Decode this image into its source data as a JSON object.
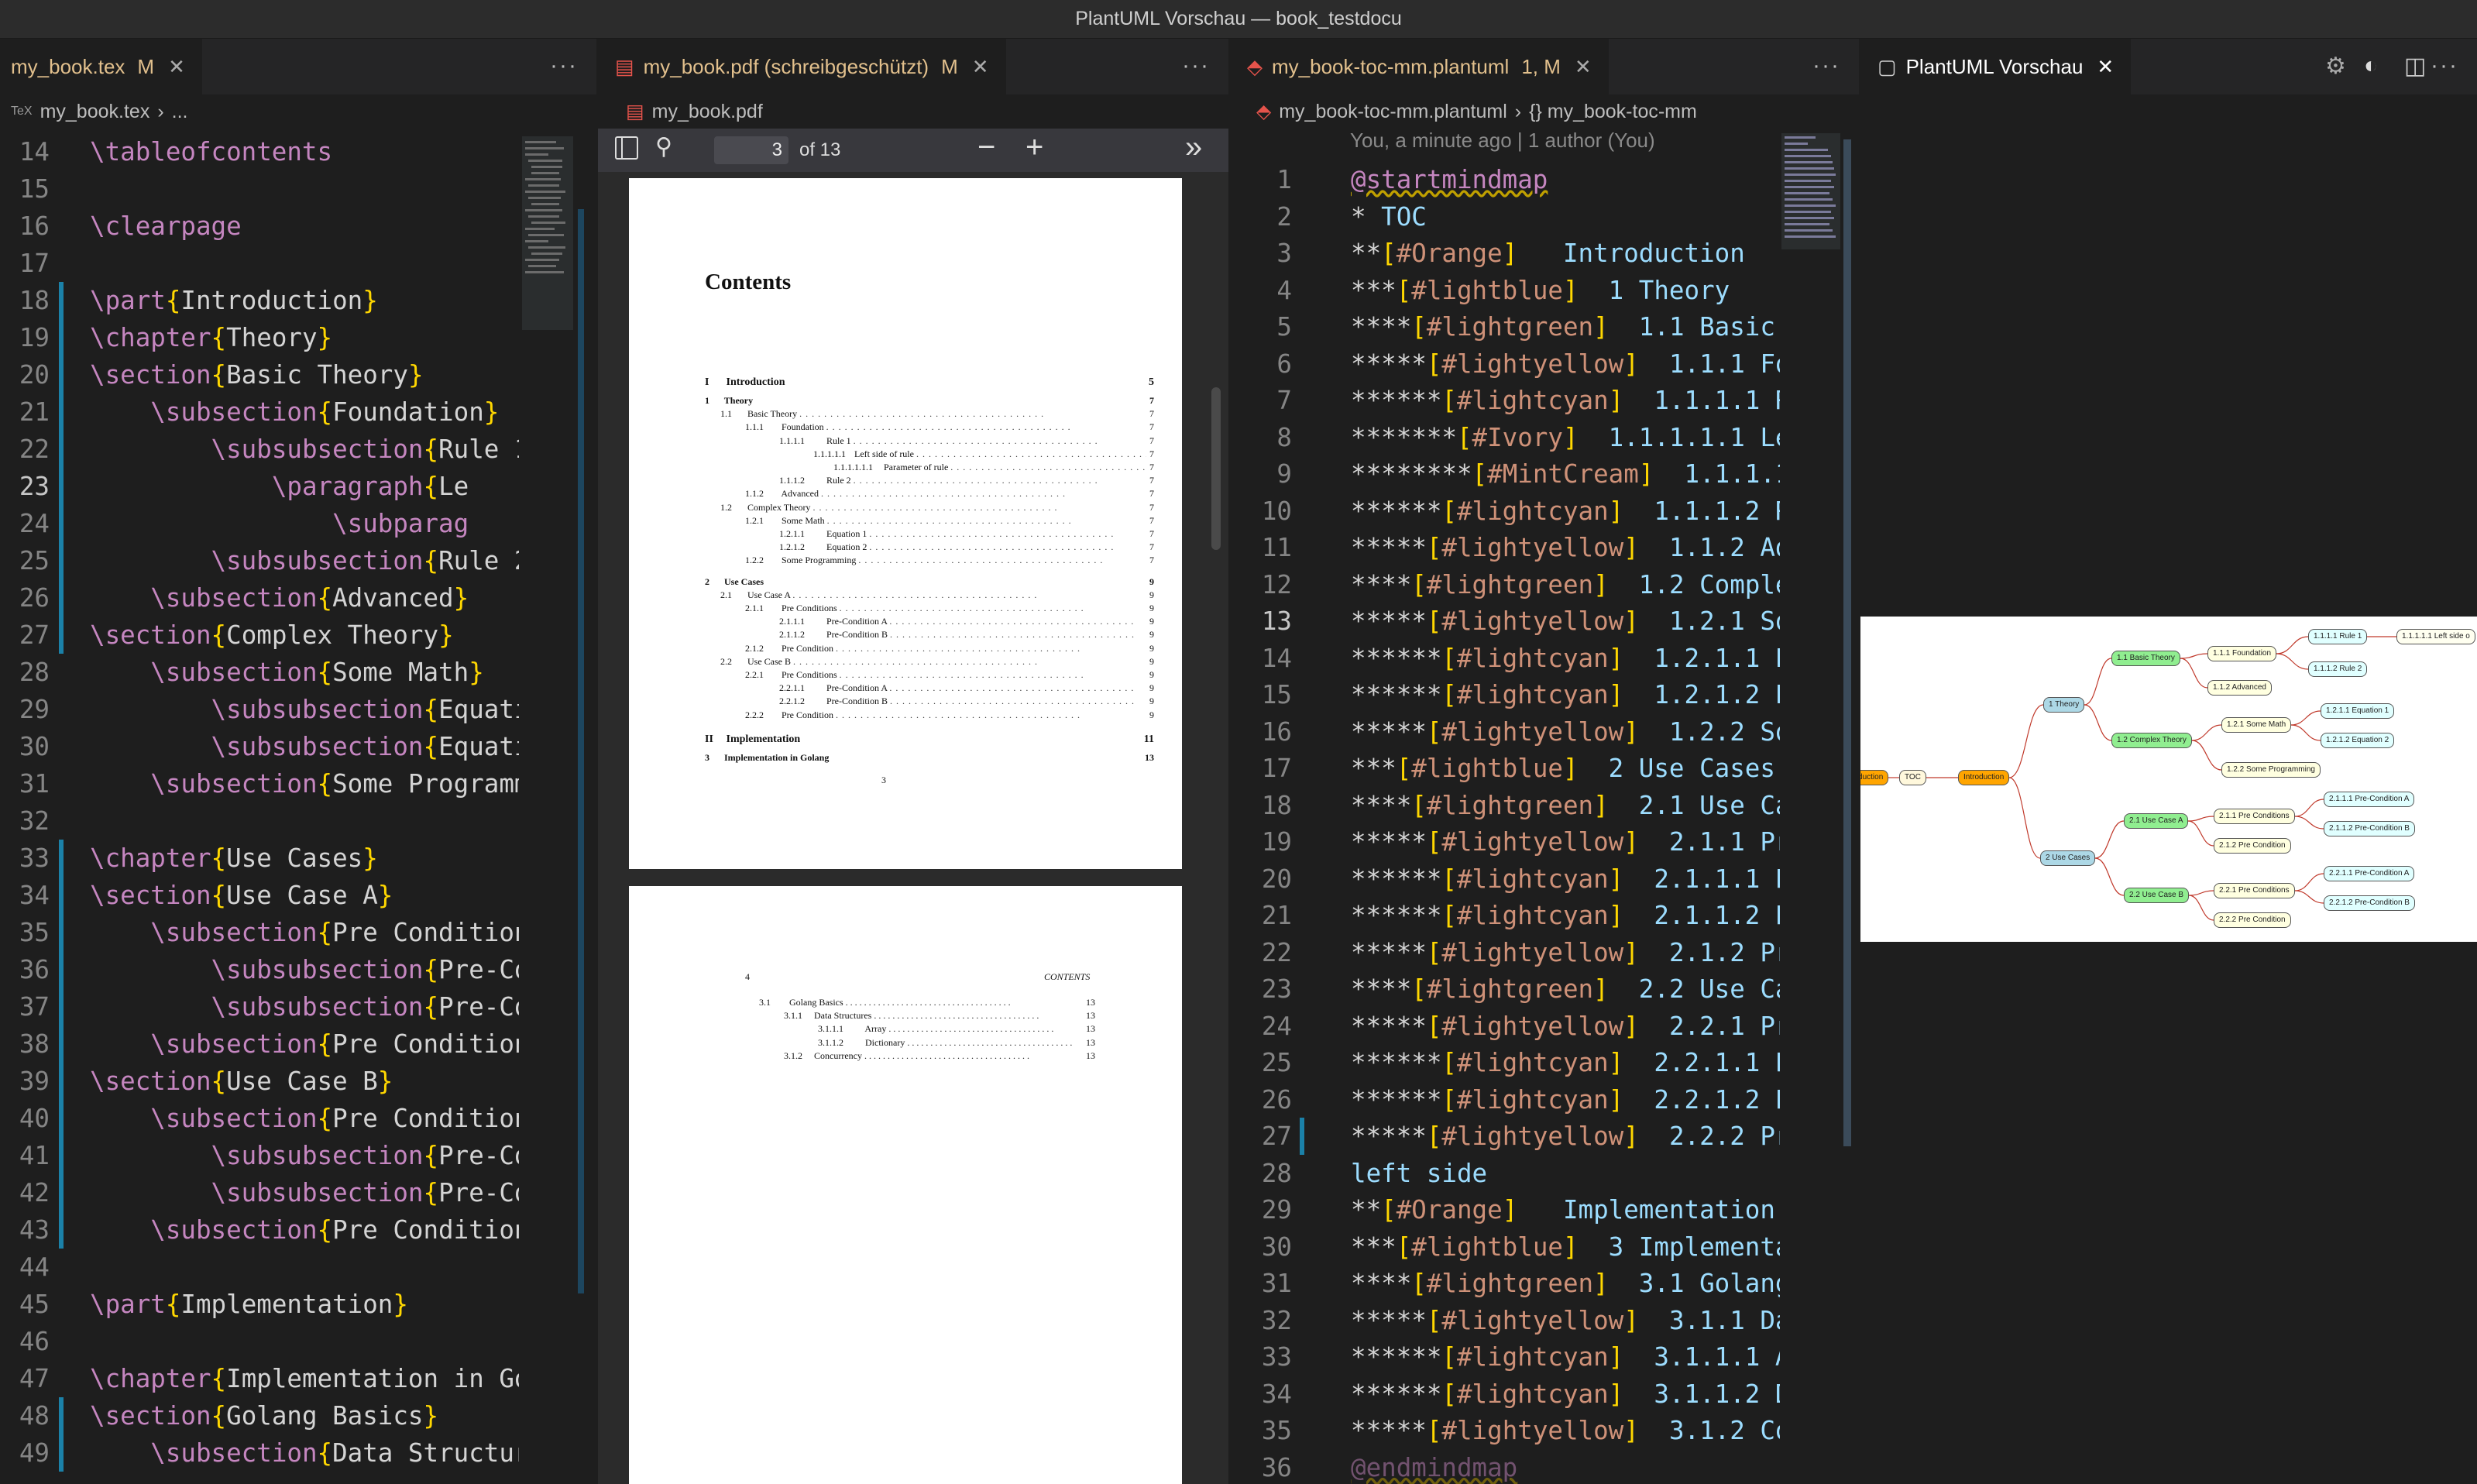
{
  "window_title": "PlantUML Vorschau — book_testdocu",
  "pane1": {
    "tab": {
      "label": "my_book.tex",
      "mod": "M"
    },
    "breadcrumb": [
      "my_book.tex",
      "..."
    ],
    "lines": [
      {
        "n": "14",
        "t": "\\tableofcontents"
      },
      {
        "n": "15",
        "t": ""
      },
      {
        "n": "16",
        "t": "\\clearpage"
      },
      {
        "n": "17",
        "t": ""
      },
      {
        "n": "18",
        "t": "\\part{Introduction}"
      },
      {
        "n": "19",
        "t": "\\chapter{Theory}"
      },
      {
        "n": "20",
        "t": "\\section{Basic Theory}"
      },
      {
        "n": "21",
        "t": "    \\subsection{Foundation}"
      },
      {
        "n": "22",
        "t": "        \\subsubsection{Rule 1"
      },
      {
        "n": "23",
        "t": "            \\paragraph{Le"
      },
      {
        "n": "24",
        "t": "                \\subparag"
      },
      {
        "n": "25",
        "t": "        \\subsubsection{Rule 2"
      },
      {
        "n": "26",
        "t": "    \\subsection{Advanced}"
      },
      {
        "n": "27",
        "t": "\\section{Complex Theory}"
      },
      {
        "n": "28",
        "t": "    \\subsection{Some Math}"
      },
      {
        "n": "29",
        "t": "        \\subsubsection{Equati"
      },
      {
        "n": "30",
        "t": "        \\subsubsection{Equati"
      },
      {
        "n": "31",
        "t": "    \\subsection{Some Programm"
      },
      {
        "n": "32",
        "t": ""
      },
      {
        "n": "33",
        "t": "\\chapter{Use Cases}"
      },
      {
        "n": "34",
        "t": "\\section{Use Case A}"
      },
      {
        "n": "35",
        "t": "    \\subsection{Pre Condition"
      },
      {
        "n": "36",
        "t": "        \\subsubsection{Pre-Co"
      },
      {
        "n": "37",
        "t": "        \\subsubsection{Pre-Co"
      },
      {
        "n": "38",
        "t": "    \\subsection{Pre Condition"
      },
      {
        "n": "39",
        "t": "\\section{Use Case B}"
      },
      {
        "n": "40",
        "t": "    \\subsection{Pre Condition"
      },
      {
        "n": "41",
        "t": "        \\subsubsection{Pre-Co"
      },
      {
        "n": "42",
        "t": "        \\subsubsection{Pre-Co"
      },
      {
        "n": "43",
        "t": "    \\subsection{Pre Condition"
      },
      {
        "n": "44",
        "t": ""
      },
      {
        "n": "45",
        "t": "\\part{Implementation}"
      },
      {
        "n": "46",
        "t": ""
      },
      {
        "n": "47",
        "t": "\\chapter{Implementation in Go"
      },
      {
        "n": "48",
        "t": "\\section{Golang Basics}"
      },
      {
        "n": "49",
        "t": "    \\subsection{Data Structur"
      }
    ]
  },
  "pane2": {
    "tab": {
      "label": "my_book.pdf (schreibgeschützt)",
      "mod": "M"
    },
    "breadcrumb": "my_book.pdf",
    "page_input": "3",
    "page_total": "of 13",
    "page3": {
      "heading": "Contents",
      "entries": [
        {
          "num": "I",
          "title": "Introduction",
          "page": "5",
          "level": 0
        },
        {
          "num": "1",
          "title": "Theory",
          "page": "7",
          "level": 1
        },
        {
          "num": "1.1",
          "title": "Basic Theory",
          "page": "7",
          "level": 2
        },
        {
          "num": "1.1.1",
          "title": "Foundation",
          "page": "7",
          "level": 3
        },
        {
          "num": "1.1.1.1",
          "title": "Rule 1",
          "page": "7",
          "level": 4
        },
        {
          "num": "1.1.1.1.1",
          "title": "Left side of rule",
          "page": "7",
          "level": 5
        },
        {
          "num": "1.1.1.1.1.1",
          "title": "Parameter of rule",
          "page": "7",
          "level": 6
        },
        {
          "num": "1.1.1.2",
          "title": "Rule 2",
          "page": "7",
          "level": 4
        },
        {
          "num": "1.1.2",
          "title": "Advanced",
          "page": "7",
          "level": 3
        },
        {
          "num": "1.2",
          "title": "Complex Theory",
          "page": "7",
          "level": 2
        },
        {
          "num": "1.2.1",
          "title": "Some Math",
          "page": "7",
          "level": 3
        },
        {
          "num": "1.2.1.1",
          "title": "Equation 1",
          "page": "7",
          "level": 4
        },
        {
          "num": "1.2.1.2",
          "title": "Equation 2",
          "page": "7",
          "level": 4
        },
        {
          "num": "1.2.2",
          "title": "Some Programming",
          "page": "7",
          "level": 3
        },
        {
          "num": "2",
          "title": "Use Cases",
          "page": "9",
          "level": 1
        },
        {
          "num": "2.1",
          "title": "Use Case A",
          "page": "9",
          "level": 2
        },
        {
          "num": "2.1.1",
          "title": "Pre Conditions",
          "page": "9",
          "level": 3
        },
        {
          "num": "2.1.1.1",
          "title": "Pre-Condition A",
          "page": "9",
          "level": 4
        },
        {
          "num": "2.1.1.2",
          "title": "Pre-Condition B",
          "page": "9",
          "level": 4
        },
        {
          "num": "2.1.2",
          "title": "Pre Condition",
          "page": "9",
          "level": 3
        },
        {
          "num": "2.2",
          "title": "Use Case B",
          "page": "9",
          "level": 2
        },
        {
          "num": "2.2.1",
          "title": "Pre Conditions",
          "page": "9",
          "level": 3
        },
        {
          "num": "2.2.1.1",
          "title": "Pre-Condition A",
          "page": "9",
          "level": 4
        },
        {
          "num": "2.2.1.2",
          "title": "Pre-Condition B",
          "page": "9",
          "level": 4
        },
        {
          "num": "2.2.2",
          "title": "Pre Condition",
          "page": "9",
          "level": 3
        },
        {
          "num": "II",
          "title": "Implementation",
          "page": "11",
          "level": 0
        },
        {
          "num": "3",
          "title": "Implementation in Golang",
          "page": "13",
          "level": 1
        }
      ],
      "footer": "3"
    },
    "page4": {
      "header_left": "4",
      "header_right": "CONTENTS",
      "entries": [
        {
          "num": "3.1",
          "title": "Golang Basics",
          "page": "13",
          "level": 2
        },
        {
          "num": "3.1.1",
          "title": "Data Structures",
          "page": "13",
          "level": 3
        },
        {
          "num": "3.1.1.1",
          "title": "Array",
          "page": "13",
          "level": 4
        },
        {
          "num": "3.1.1.2",
          "title": "Dictionary",
          "page": "13",
          "level": 4
        },
        {
          "num": "3.1.2",
          "title": "Concurrency",
          "page": "13",
          "level": 3
        }
      ]
    }
  },
  "pane3": {
    "tab": {
      "label": "my_book-toc-mm.plantuml",
      "mod": "1, M"
    },
    "breadcrumb": [
      "my_book-toc-mm.plantuml",
      "{} my_book-toc-mm"
    ],
    "blame": "You, a minute ago | 1 author (You)",
    "lines": [
      {
        "n": "1",
        "s": "",
        "c": "",
        "t": "@startmindmap"
      },
      {
        "n": "2",
        "s": "* ",
        "c": "",
        "t": "TOC"
      },
      {
        "n": "3",
        "s": "**",
        "c": "[#Orange]",
        "t": "   Introduction"
      },
      {
        "n": "4",
        "s": "***",
        "c": "[#lightblue]",
        "t": "  1 Theory"
      },
      {
        "n": "5",
        "s": "****",
        "c": "[#lightgreen]",
        "t": "  1.1 Basic"
      },
      {
        "n": "6",
        "s": "*****",
        "c": "[#lightyellow]",
        "t": "  1.1.1 Fo"
      },
      {
        "n": "7",
        "s": "******",
        "c": "[#lightcyan]",
        "t": "  1.1.1.1 R"
      },
      {
        "n": "8",
        "s": "*******",
        "c": "[#Ivory]",
        "t": "  1.1.1.1.1 Le"
      },
      {
        "n": "9",
        "s": "********",
        "c": "[#MintCream]",
        "t": "  1.1.1.1"
      },
      {
        "n": "10",
        "s": "******",
        "c": "[#lightcyan]",
        "t": "  1.1.1.2 R"
      },
      {
        "n": "11",
        "s": "*****",
        "c": "[#lightyellow]",
        "t": "  1.1.2 Ad"
      },
      {
        "n": "12",
        "s": "****",
        "c": "[#lightgreen]",
        "t": "  1.2 Comple"
      },
      {
        "n": "13",
        "s": "*****",
        "c": "[#lightyellow]",
        "t": "  1.2.1 So"
      },
      {
        "n": "14",
        "s": "******",
        "c": "[#lightcyan]",
        "t": "  1.2.1.1 E"
      },
      {
        "n": "15",
        "s": "******",
        "c": "[#lightcyan]",
        "t": "  1.2.1.2 E"
      },
      {
        "n": "16",
        "s": "*****",
        "c": "[#lightyellow]",
        "t": "  1.2.2 So"
      },
      {
        "n": "17",
        "s": "***",
        "c": "[#lightblue]",
        "t": "  2 Use Cases"
      },
      {
        "n": "18",
        "s": "****",
        "c": "[#lightgreen]",
        "t": "  2.1 Use Ca"
      },
      {
        "n": "19",
        "s": "*****",
        "c": "[#lightyellow]",
        "t": "  2.1.1 Pr"
      },
      {
        "n": "20",
        "s": "******",
        "c": "[#lightcyan]",
        "t": "  2.1.1.1 P"
      },
      {
        "n": "21",
        "s": "******",
        "c": "[#lightcyan]",
        "t": "  2.1.1.2 P"
      },
      {
        "n": "22",
        "s": "*****",
        "c": "[#lightyellow]",
        "t": "  2.1.2 Pr"
      },
      {
        "n": "23",
        "s": "****",
        "c": "[#lightgreen]",
        "t": "  2.2 Use Ca"
      },
      {
        "n": "24",
        "s": "*****",
        "c": "[#lightyellow]",
        "t": "  2.2.1 Pr"
      },
      {
        "n": "25",
        "s": "******",
        "c": "[#lightcyan]",
        "t": "  2.2.1.1 P"
      },
      {
        "n": "26",
        "s": "******",
        "c": "[#lightcyan]",
        "t": "  2.2.1.2 P"
      },
      {
        "n": "27",
        "s": "*****",
        "c": "[#lightyellow]",
        "t": "  2.2.2 Pr"
      },
      {
        "n": "28",
        "s": "",
        "c": "",
        "t": "left side"
      },
      {
        "n": "29",
        "s": "**",
        "c": "[#Orange]",
        "t": "   Implementation"
      },
      {
        "n": "30",
        "s": "***",
        "c": "[#lightblue]",
        "t": "  3 Implementa"
      },
      {
        "n": "31",
        "s": "****",
        "c": "[#lightgreen]",
        "t": "  3.1 Golang"
      },
      {
        "n": "32",
        "s": "*****",
        "c": "[#lightyellow]",
        "t": "  3.1.1 Da"
      },
      {
        "n": "33",
        "s": "******",
        "c": "[#lightcyan]",
        "t": "  3.1.1.1 A"
      },
      {
        "n": "34",
        "s": "******",
        "c": "[#lightcyan]",
        "t": "  3.1.1.2 D"
      },
      {
        "n": "35",
        "s": "*****",
        "c": "[#lightyellow]",
        "t": "  3.1.2 Co"
      },
      {
        "n": "36",
        "s": "",
        "c": "",
        "t": "@endmindmap"
      }
    ]
  },
  "pane4": {
    "tab": {
      "label": "PlantUML Vorschau"
    },
    "mindmap": {
      "nodes": [
        {
          "id": "root_left",
          "label": "Introduction",
          "color": "#ffa500"
        },
        {
          "id": "toc",
          "label": "TOC",
          "color": "#fff8dc"
        },
        {
          "id": "intro",
          "label": "Introduction",
          "color": "#ffa500"
        },
        {
          "id": "theory",
          "label": "1 Theory",
          "color": "#add8e6"
        },
        {
          "id": "basic",
          "label": "1.1 Basic Theory",
          "color": "#90ee90"
        },
        {
          "id": "found",
          "label": "1.1.1 Foundation",
          "color": "#ffffe0"
        },
        {
          "id": "rule1",
          "label": "1.1.1.1 Rule 1",
          "color": "#e0ffff"
        },
        {
          "id": "left",
          "label": "1.1.1.1.1 Left side o",
          "color": "#fffff0"
        },
        {
          "id": "rule2",
          "label": "1.1.1.2 Rule 2",
          "color": "#e0ffff"
        },
        {
          "id": "adv",
          "label": "1.1.2 Advanced",
          "color": "#ffffe0"
        },
        {
          "id": "complex",
          "label": "1.2 Complex Theory",
          "color": "#90ee90"
        },
        {
          "id": "math",
          "label": "1.2.1 Some Math",
          "color": "#ffffe0"
        },
        {
          "id": "eq1",
          "label": "1.2.1.1 Equation 1",
          "color": "#e0ffff"
        },
        {
          "id": "eq2",
          "label": "1.2.1.2 Equation 2",
          "color": "#e0ffff"
        },
        {
          "id": "prog",
          "label": "1.2.2 Some Programming",
          "color": "#ffffe0"
        },
        {
          "id": "usecases",
          "label": "2 Use Cases",
          "color": "#add8e6"
        },
        {
          "id": "uca",
          "label": "2.1 Use Case A",
          "color": "#90ee90"
        },
        {
          "id": "pca",
          "label": "2.1.1 Pre Conditions",
          "color": "#ffffe0"
        },
        {
          "id": "pcaa",
          "label": "2.1.1.1 Pre-Condition A",
          "color": "#e0ffff"
        },
        {
          "id": "pcab",
          "label": "2.1.1.2 Pre-Condition B",
          "color": "#e0ffff"
        },
        {
          "id": "pc2",
          "label": "2.1.2 Pre Condition",
          "color": "#ffffe0"
        },
        {
          "id": "ucb",
          "label": "2.2 Use Case B",
          "color": "#90ee90"
        },
        {
          "id": "pcb",
          "label": "2.2.1 Pre Conditions",
          "color": "#ffffe0"
        },
        {
          "id": "pcba",
          "label": "2.2.1.1 Pre-Condition A",
          "color": "#e0ffff"
        },
        {
          "id": "pcbb",
          "label": "2.2.1.2 Pre-Condition B",
          "color": "#e0ffff"
        },
        {
          "id": "pc22",
          "label": "2.2.2 Pre Condition",
          "color": "#ffffe0"
        }
      ]
    }
  }
}
